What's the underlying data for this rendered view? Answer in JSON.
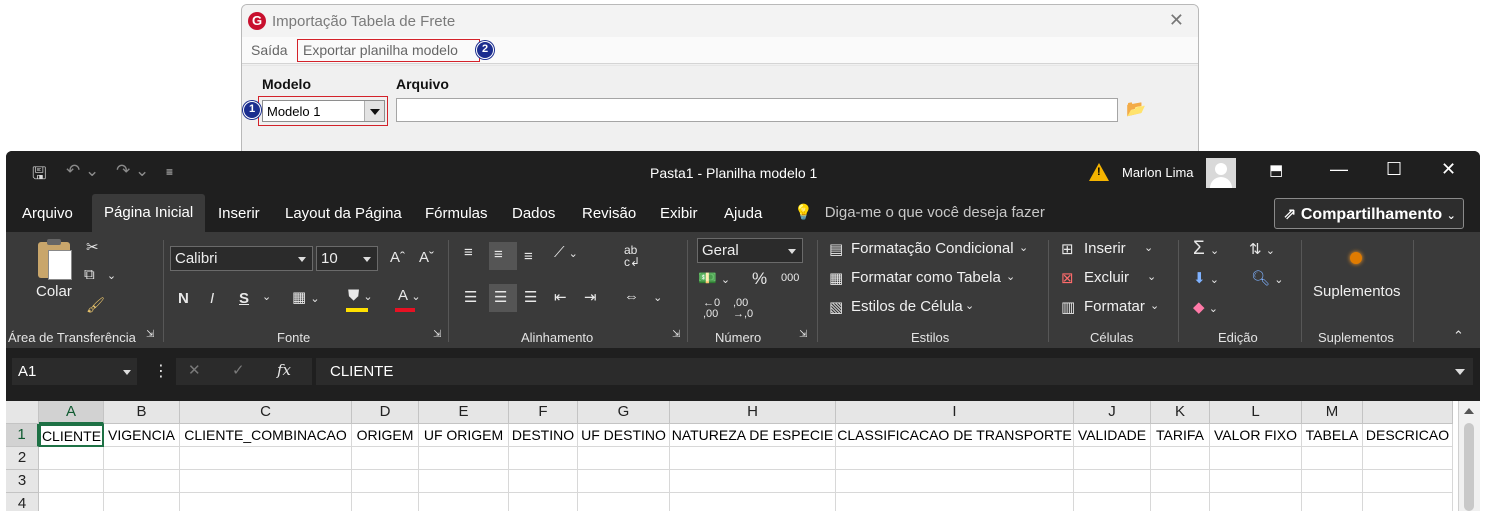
{
  "dialog": {
    "title": "Importação Tabela de Frete",
    "logo_letter": "G",
    "close": "✕",
    "menu": {
      "saida": "Saída",
      "exportar": "Exportar planilha modelo"
    },
    "badge1": "1",
    "badge2": "2",
    "modelo_label": "Modelo",
    "arquivo_label": "Arquivo",
    "modelo_value": "Modelo 1",
    "arquivo_value": ""
  },
  "excel": {
    "window_title": "Pasta1  -  Planilha modelo 1",
    "user_name": "Marlon Lima",
    "tabs": [
      "Arquivo",
      "Página Inicial",
      "Inserir",
      "Layout da Página",
      "Fórmulas",
      "Dados",
      "Revisão",
      "Exibir",
      "Ajuda"
    ],
    "tell_me": "Diga-me o que você deseja fazer",
    "share": "Compartilhamento",
    "ribbon": {
      "clipboard": {
        "paste": "Colar",
        "label": "Área de Transferência"
      },
      "font": {
        "family": "Calibri",
        "size": "10",
        "bold": "N",
        "italic": "I",
        "underline": "S",
        "label": "Fonte"
      },
      "alignment": {
        "label": "Alinhamento"
      },
      "number": {
        "format": "Geral",
        "percent": "%",
        "thousands": "000",
        "label": "Número"
      },
      "styles": {
        "conditional": "Formatação Condicional",
        "as_table": "Formatar como Tabela",
        "cell_styles": "Estilos de Célula",
        "label": "Estilos"
      },
      "cells": {
        "insert": "Inserir",
        "delete": "Excluir",
        "format": "Formatar",
        "label": "Células"
      },
      "editing": {
        "label": "Edição"
      },
      "addins": {
        "button": "Suplementos",
        "label": "Suplementos"
      }
    },
    "name_box": "A1",
    "formula": "CLIENTE",
    "fx": "fx",
    "columns": [
      "A",
      "B",
      "C",
      "D",
      "E",
      "F",
      "G",
      "H",
      "I",
      "J",
      "K",
      "L",
      "M"
    ],
    "rows": [
      "1",
      "2",
      "3",
      "4"
    ],
    "row1": [
      "CLIENTE",
      "VIGENCIA",
      "CLIENTE_COMBINACAO",
      "ORIGEM",
      "UF ORIGEM",
      "DESTINO",
      "UF DESTINO",
      "NATUREZA DE ESPECIE",
      "CLASSIFICACAO DE TRANSPORTE",
      "VALIDADE",
      "TARIFA",
      "VALOR FIXO",
      "TABELA",
      "DESCRICAO"
    ]
  }
}
